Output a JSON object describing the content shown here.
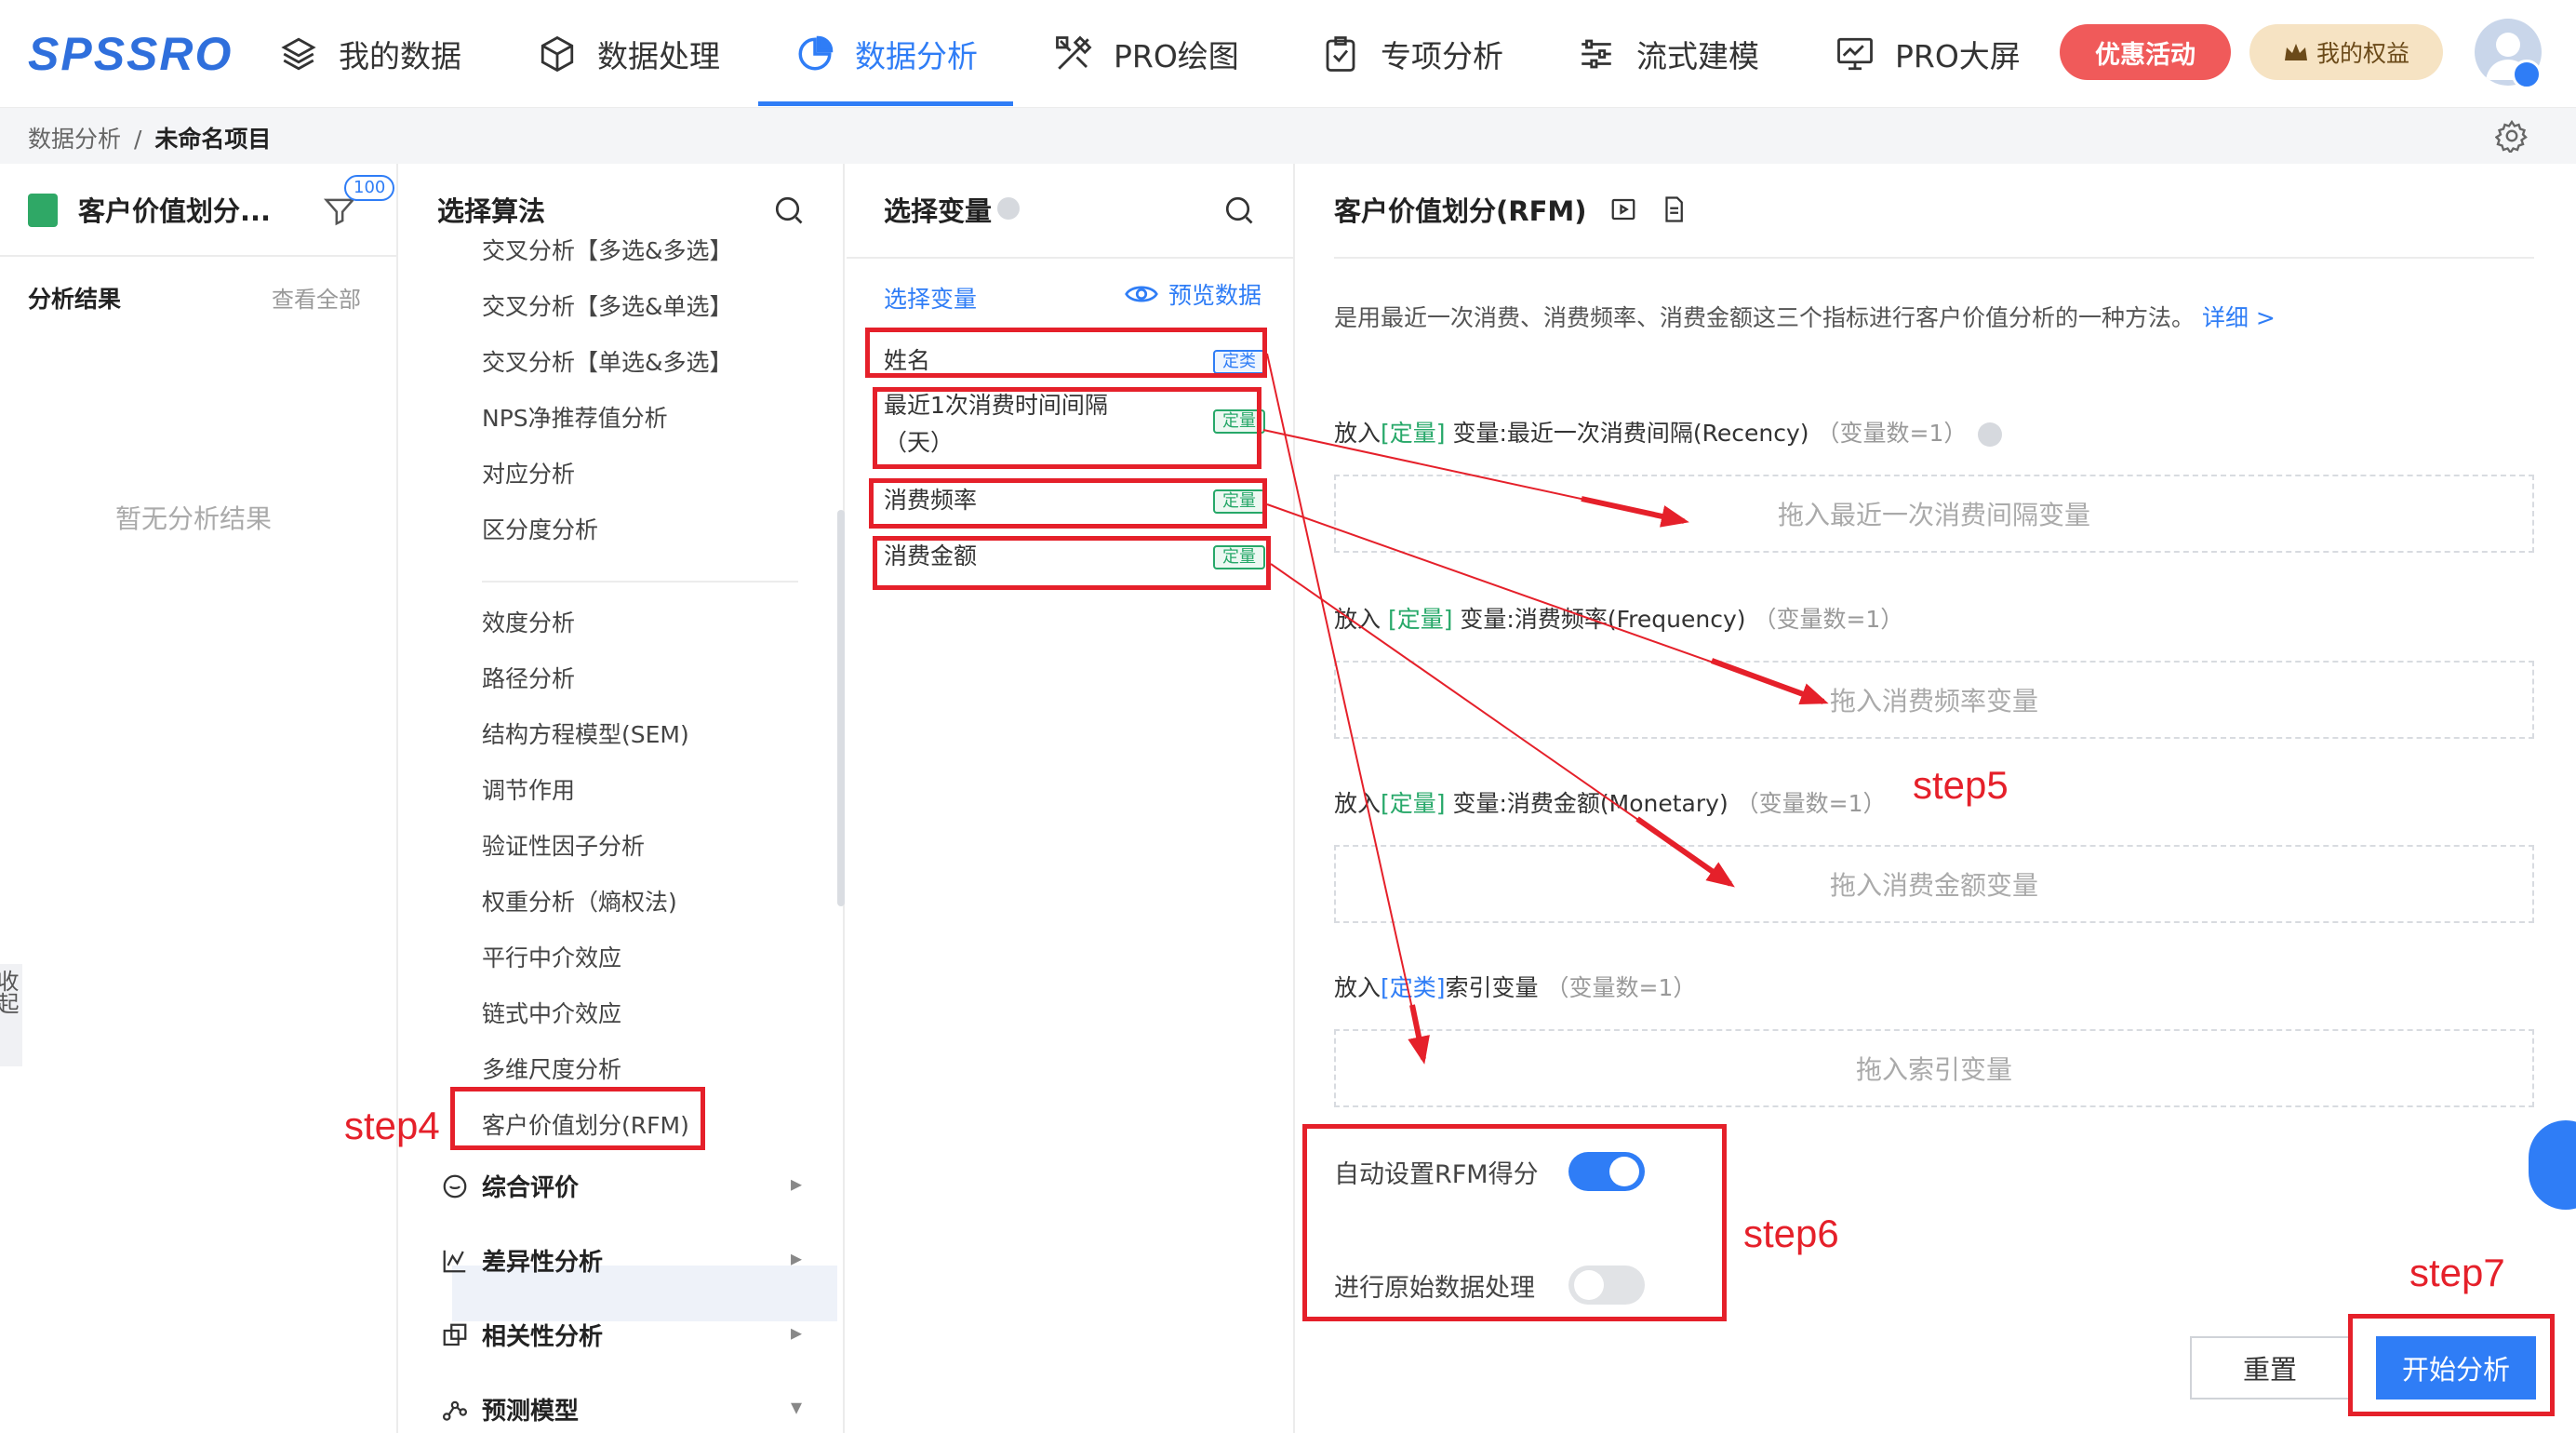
{
  "app": {
    "logo": "SPSSRO",
    "nav": [
      {
        "label": "我的数据",
        "icon": "layers-icon"
      },
      {
        "label": "数据处理",
        "icon": "cube-icon"
      },
      {
        "label": "数据分析",
        "icon": "pie-chart-icon",
        "active": true
      },
      {
        "label": "PRO绘图",
        "icon": "drawing-tools-icon"
      },
      {
        "label": "专项分析",
        "icon": "clipboard-check-icon"
      },
      {
        "label": "流式建模",
        "icon": "sliders-icon"
      },
      {
        "label": "PRO大屏",
        "icon": "monitor-chart-icon"
      }
    ],
    "promo_label": "优惠活动",
    "rights_label": "我的权益",
    "accent_color": "#2f7df6",
    "promo_color": "#f05a5a"
  },
  "breadcrumb": {
    "parent": "数据分析",
    "separator": "/",
    "current": "未命名项目"
  },
  "project_panel": {
    "title": "客户价值划分...",
    "filter_count": "100",
    "results_label": "分析结果",
    "view_all": "查看全部",
    "empty_text": "暂无分析结果",
    "collapse_label": "收起"
  },
  "algorithm_panel": {
    "title": "选择算法",
    "items": [
      "交叉分析【多选&多选】",
      "交叉分析【多选&单选】",
      "交叉分析【单选&多选】",
      "NPS净推荐值分析",
      "对应分析",
      "区分度分析",
      "效度分析",
      "路径分析",
      "结构方程模型(SEM)",
      "调节作用",
      "验证性因子分析",
      "权重分析（熵权法)",
      "平行中介效应",
      "链式中介效应",
      "多维尺度分析",
      "客户价值划分(RFM)"
    ],
    "active_index": 15,
    "groups": [
      {
        "label": "综合评价",
        "icon": "chat-bubble-icon",
        "arrow": "▸"
      },
      {
        "label": "差异性分析",
        "icon": "line-chart-icon",
        "arrow": "▸"
      },
      {
        "label": "相关性分析",
        "icon": "copy-squares-icon",
        "arrow": "▸"
      },
      {
        "label": "预测模型",
        "icon": "scatter-nodes-icon",
        "arrow": "▾"
      }
    ]
  },
  "variable_panel": {
    "title": "选择变量",
    "select_link": "选择变量",
    "preview_link": "预览数据",
    "variables": [
      {
        "name": "姓名",
        "tag": "定类",
        "tag_color": "#2f7df6"
      },
      {
        "name": "最近1次消费时间间隔",
        "name_line2": "（天）",
        "tag": "定量",
        "tag_color": "#27a869"
      },
      {
        "name": "消费频率",
        "tag": "定量",
        "tag_color": "#27a869"
      },
      {
        "name": "消费金额",
        "tag": "定量",
        "tag_color": "#27a869"
      }
    ]
  },
  "rfm_panel": {
    "title": "客户价值划分(RFM)",
    "description": "是用最近一次消费、消费频率、消费金额这三个指标进行客户价值分析的一种方法。",
    "more_link": "详细 >",
    "slots": [
      {
        "prefix": "放入",
        "tag": "[定量]",
        "label": " 变量:最近一次消费间隔(Recency)",
        "count": "（变量数=1）",
        "placeholder": "拖入最近一次消费间隔变量",
        "help": true
      },
      {
        "prefix": "放入 ",
        "tag": "[定量]",
        "label": " 变量:消费频率(Frequency)",
        "count": "（变量数=1）",
        "placeholder": "拖入消费频率变量",
        "help": false
      },
      {
        "prefix": "放入",
        "tag": "[定量]",
        "label": " 变量:消费金额(Monetary)",
        "count": "（变量数=1）",
        "placeholder": "拖入消费金额变量",
        "help": false
      },
      {
        "prefix": "放入",
        "tag": "[定类]",
        "label": "索引变量",
        "count": "（变量数=1）",
        "placeholder": "拖入索引变量",
        "help": false
      }
    ],
    "toggles": [
      {
        "label": "自动设置RFM得分",
        "on": true
      },
      {
        "label": "进行原始数据处理",
        "on": false
      }
    ],
    "reset_label": "重置",
    "start_label": "开始分析"
  },
  "annotations": {
    "step4": "step4",
    "step5": "step5",
    "step6": "step6",
    "step7": "step7",
    "color": "#e5202a"
  }
}
